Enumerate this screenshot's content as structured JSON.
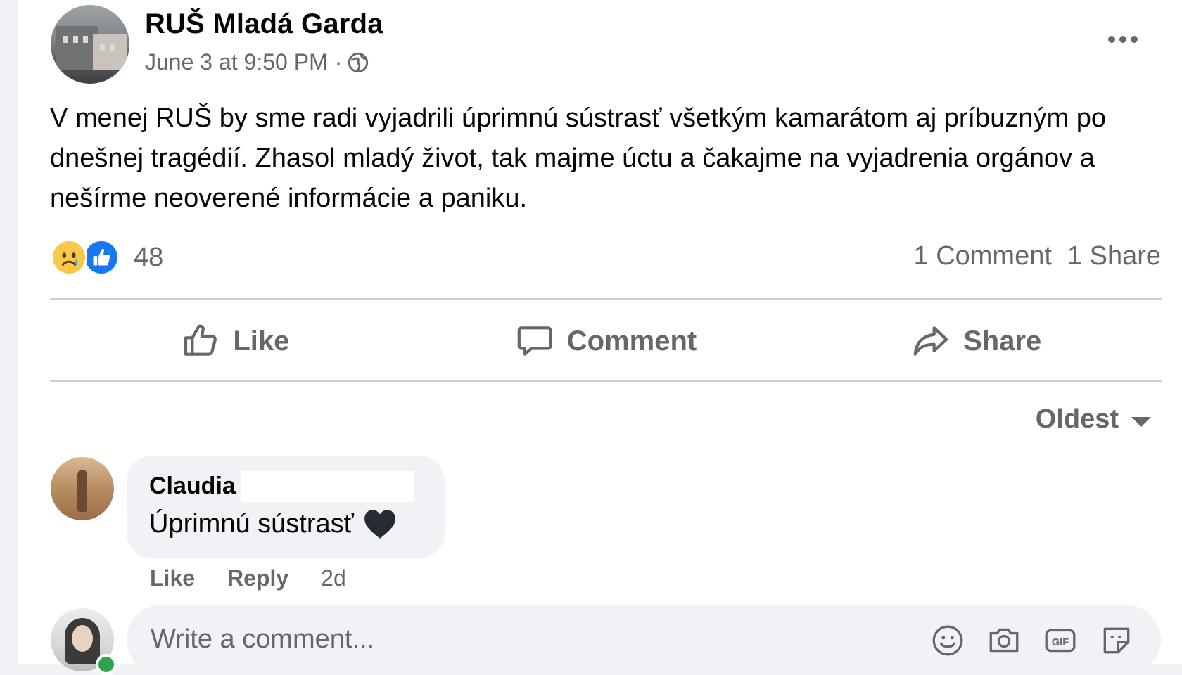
{
  "post": {
    "page_name": "RUŠ Mladá Garda",
    "timestamp": "June 3 at 9:50 PM",
    "separator": "·",
    "privacy_icon": "globe-icon",
    "more_icon": "more-horizontal-icon",
    "text": "V menej RUŠ by sme radi vyjadrili úprimnú sústrasť všetkým kamarátom aj príbuzným po dnešnej tragédií. Zhasol mladý život, tak majme úctu a čakajme na vyjadrenia orgánov a nešírme neoverené informácie a paniku.",
    "reactions": {
      "icons": [
        "sad-reaction-icon",
        "like-reaction-icon"
      ],
      "count": "48"
    },
    "comments_count": "1 Comment",
    "shares_count": "1 Share"
  },
  "actions": {
    "like_label": "Like",
    "comment_label": "Comment",
    "share_label": "Share"
  },
  "comments_sort": {
    "selected": "Oldest"
  },
  "comments": [
    {
      "author": "Claudia",
      "text": "Úprimnú sústrasť",
      "emoji": "black-heart-icon",
      "like_label": "Like",
      "reply_label": "Reply",
      "time": "2d"
    }
  ],
  "composer": {
    "placeholder": "Write a comment...",
    "icons": [
      "emoji-icon",
      "camera-icon",
      "gif-icon",
      "sticker-icon"
    ]
  },
  "colors": {
    "text_primary": "#050505",
    "text_secondary": "#65676b",
    "divider": "#ced0d4",
    "bubble_bg": "#f0f2f5",
    "like_blue": "#1877f2",
    "online_green": "#31a24c"
  }
}
